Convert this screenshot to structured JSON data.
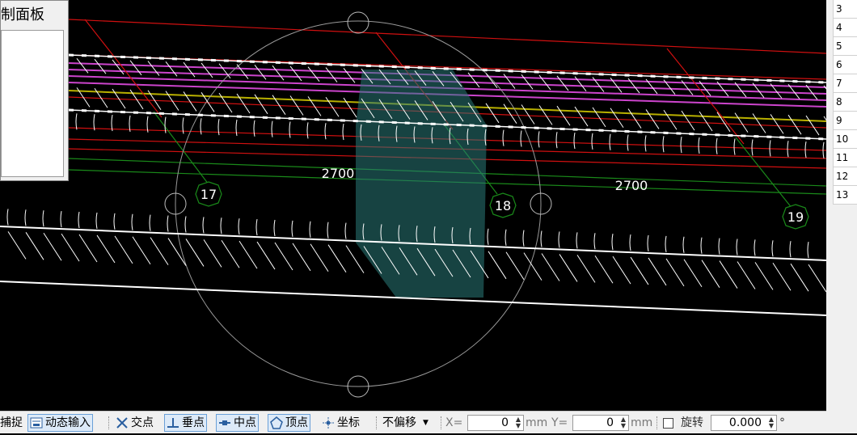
{
  "panel": {
    "title": "制面板"
  },
  "row_numbers": [
    "3",
    "4",
    "5",
    "6",
    "7",
    "8",
    "9",
    "10",
    "11",
    "12",
    "13"
  ],
  "canvas": {
    "axis_labels": [
      "17",
      "18",
      "19"
    ],
    "dimension_labels": [
      "2700",
      "2700"
    ]
  },
  "toolbar": {
    "snap_label": "捕捉",
    "dynamic_input_label": "动态输入",
    "intersection_label": "交点",
    "perpendicular_label": "垂点",
    "midpoint_label": "中点",
    "vertex_label": "顶点",
    "coordinate_label": "坐标",
    "offset_select": "不偏移",
    "x_label": "X=",
    "x_value": "0",
    "x_unit": "mm",
    "y_label": "Y=",
    "y_value": "0",
    "y_unit": "mm",
    "rotate_label": "旋转",
    "rotate_value": "0.000",
    "degree_symbol": "°"
  },
  "colors": {
    "background": "#000000",
    "rebar_white": "#ffffff",
    "axis_red": "#d01010",
    "axis_green": "#1a8a1a",
    "magenta": "#cc44cc",
    "yellow": "#b8b000",
    "highlight": "#2a7a78"
  }
}
